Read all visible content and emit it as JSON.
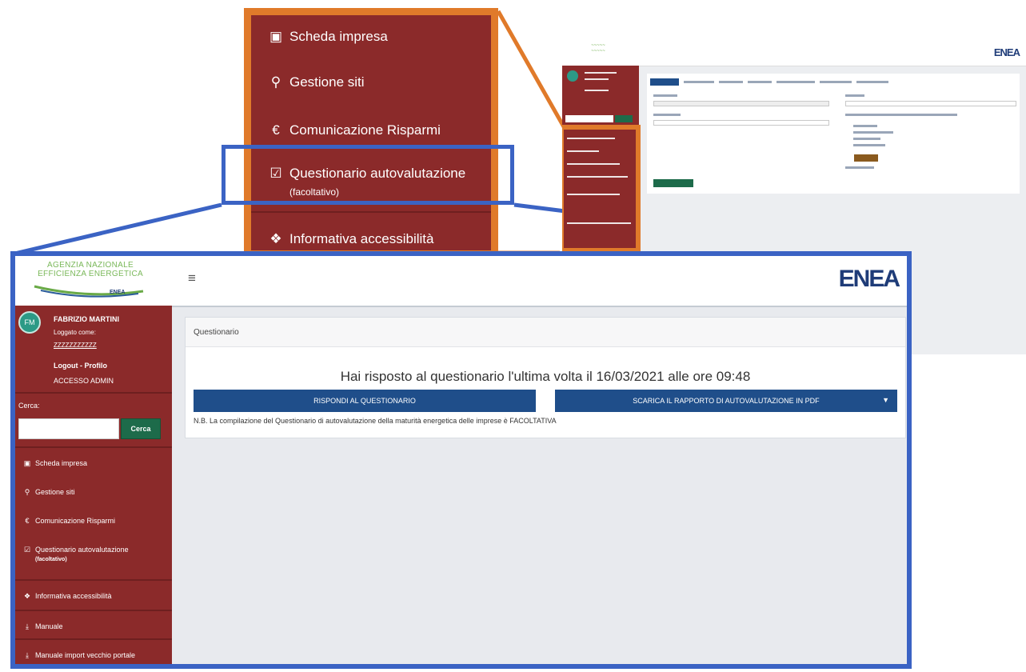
{
  "zoom_menu": {
    "items": [
      {
        "label": "Scheda impresa",
        "icon": "briefcase-icon"
      },
      {
        "label": "Gestione siti",
        "icon": "map-marker-icon"
      },
      {
        "label": "Comunicazione Risparmi",
        "icon": "euro-icon"
      },
      {
        "label": "Questionario autovalutazione",
        "sub": "(facoltativo)",
        "icon": "checkbox-icon"
      },
      {
        "label": "Informativa accessibilità",
        "icon": "info-icon"
      }
    ]
  },
  "header": {
    "logo_text": [
      "AGENZIA NAZIONALE",
      "EFFICIENZA ENERGETICA"
    ],
    "logo_sub": "ENEA",
    "menu_toggle": "≡",
    "brand": "ENEA"
  },
  "user": {
    "avatar": "FM",
    "name": "FABRIZIO MARTINI",
    "logged_as": "Loggato come:",
    "code": "ZZZZZZZZZZZ",
    "logout": "Logout",
    "separator": " - ",
    "profile": "Profilo",
    "admin": "ACCESSO ADMIN"
  },
  "search": {
    "label": "Cerca:",
    "placeholder": "",
    "button": "Cerca"
  },
  "sidebar": {
    "items": [
      {
        "label": "Scheda impresa",
        "icon": "briefcase-icon"
      },
      {
        "label": "Gestione siti",
        "icon": "map-marker-icon"
      },
      {
        "label": "Comunicazione Risparmi",
        "icon": "euro-icon"
      },
      {
        "label": "Questionario autovalutazione",
        "sub": "(facoltativo)",
        "icon": "checkbox-icon"
      },
      {
        "label": "Informativa accessibilità",
        "icon": "info-icon"
      },
      {
        "label": "Manuale",
        "icon": "download-icon"
      },
      {
        "label": "Manuale import vecchio portale",
        "icon": "download-icon"
      }
    ]
  },
  "card": {
    "breadcrumb": "Questionario",
    "title": "Hai risposto al questionario l'ultima volta il 16/03/2021 alle ore 09:48",
    "respond_button": "RISPONDI AL QUESTIONARIO",
    "download_button": "SCARICA IL RAPPORTO DI AUTOVALUTAZIONE IN PDF",
    "note": "N.B. La compilazione del Questionario di autovalutazione della maturità energetica delle imprese è FACOLTATIVA"
  },
  "colors": {
    "sidebar": "#8b2a2a",
    "callout_orange": "#e07a2a",
    "callout_blue": "#3b63c4",
    "primary_button": "#1f4e8a",
    "search_button": "#1d6b4a"
  }
}
